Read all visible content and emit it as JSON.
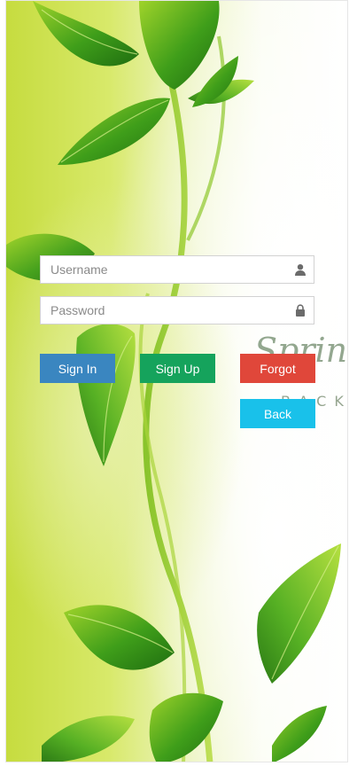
{
  "form": {
    "username": {
      "placeholder": "Username",
      "value": "",
      "icon": "user-icon"
    },
    "password": {
      "placeholder": "Password",
      "value": "",
      "icon": "lock-icon"
    }
  },
  "buttons": {
    "signin": {
      "label": "Sign In",
      "color": "#3a86c0"
    },
    "signup": {
      "label": "Sign Up",
      "color": "#15a35c"
    },
    "forgot": {
      "label": "Forgot",
      "color": "#e0473a"
    },
    "back": {
      "label": "Back",
      "color": "#19c1ea"
    }
  },
  "background": {
    "watermark_script": "Spring L",
    "watermark_caps": "B A C K G"
  }
}
